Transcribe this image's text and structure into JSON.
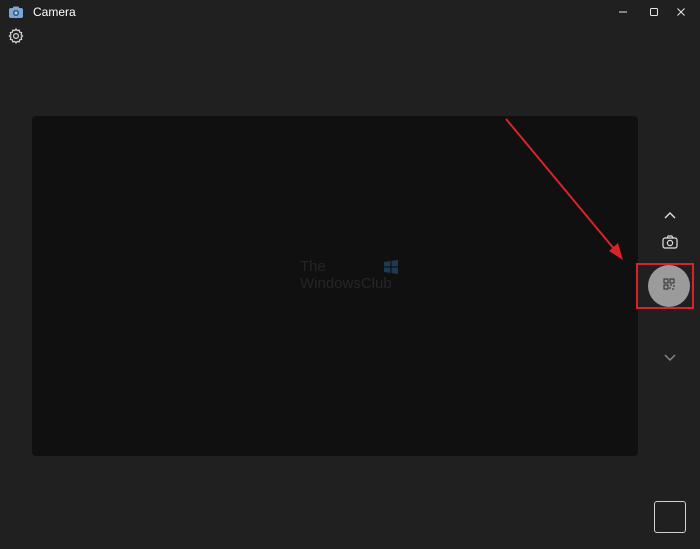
{
  "window": {
    "title": "Camera",
    "icon": "camera-app-icon",
    "controls": [
      "minimize-icon",
      "maximize-icon",
      "close-icon"
    ]
  },
  "toolbar": {
    "settings_icon": "gear-icon"
  },
  "viewfinder": {
    "watermark_line1": "The",
    "watermark_line2": "WindowsClub"
  },
  "controls": {
    "mode_up_icon": "chevron-up-icon",
    "photo_mode_icon": "camera-icon",
    "capture_icon": "qr-scan-icon",
    "mode_down_icon": "chevron-down-icon",
    "gallery_icon": "gallery-thumbnail"
  },
  "annotation": {
    "color": "#d9232a",
    "highlight": "capture-button"
  },
  "colors": {
    "background": "#202020",
    "viewfinder": "#101010",
    "capture_button": "#9b9b9b",
    "accent_red": "#d9232a"
  }
}
